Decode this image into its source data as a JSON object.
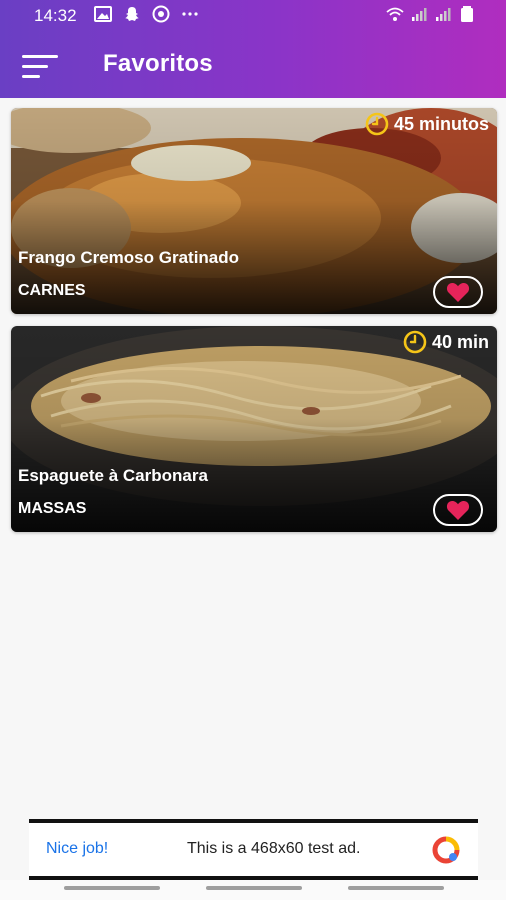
{
  "status_bar": {
    "time": "14:32",
    "left_icons": [
      "image-icon",
      "snapchat-icon",
      "chrome-icon",
      "more-dots-icon"
    ],
    "right_icons": [
      "wifi-icon",
      "signal-icon",
      "signal-icon",
      "battery-icon"
    ]
  },
  "app_bar": {
    "title": "Favoritos",
    "menu_icon": "sort-menu-icon"
  },
  "recipes": [
    {
      "name": "Frango Cremoso Gratinado",
      "category": "CARNES",
      "time": "45 minutos",
      "favorite": true
    },
    {
      "name": "Espaguete à Carbonara",
      "category": "MASSAS",
      "time": "40 min",
      "favorite": true
    }
  ],
  "ad": {
    "nice": "Nice job!",
    "text": "This is a 468x60 test ad."
  },
  "colors": {
    "gradient_start": "#6a3fc4",
    "gradient_end": "#b02dbf",
    "clock": "#f5c518",
    "heart": "#e5245a",
    "ad_link": "#1a73e8"
  }
}
